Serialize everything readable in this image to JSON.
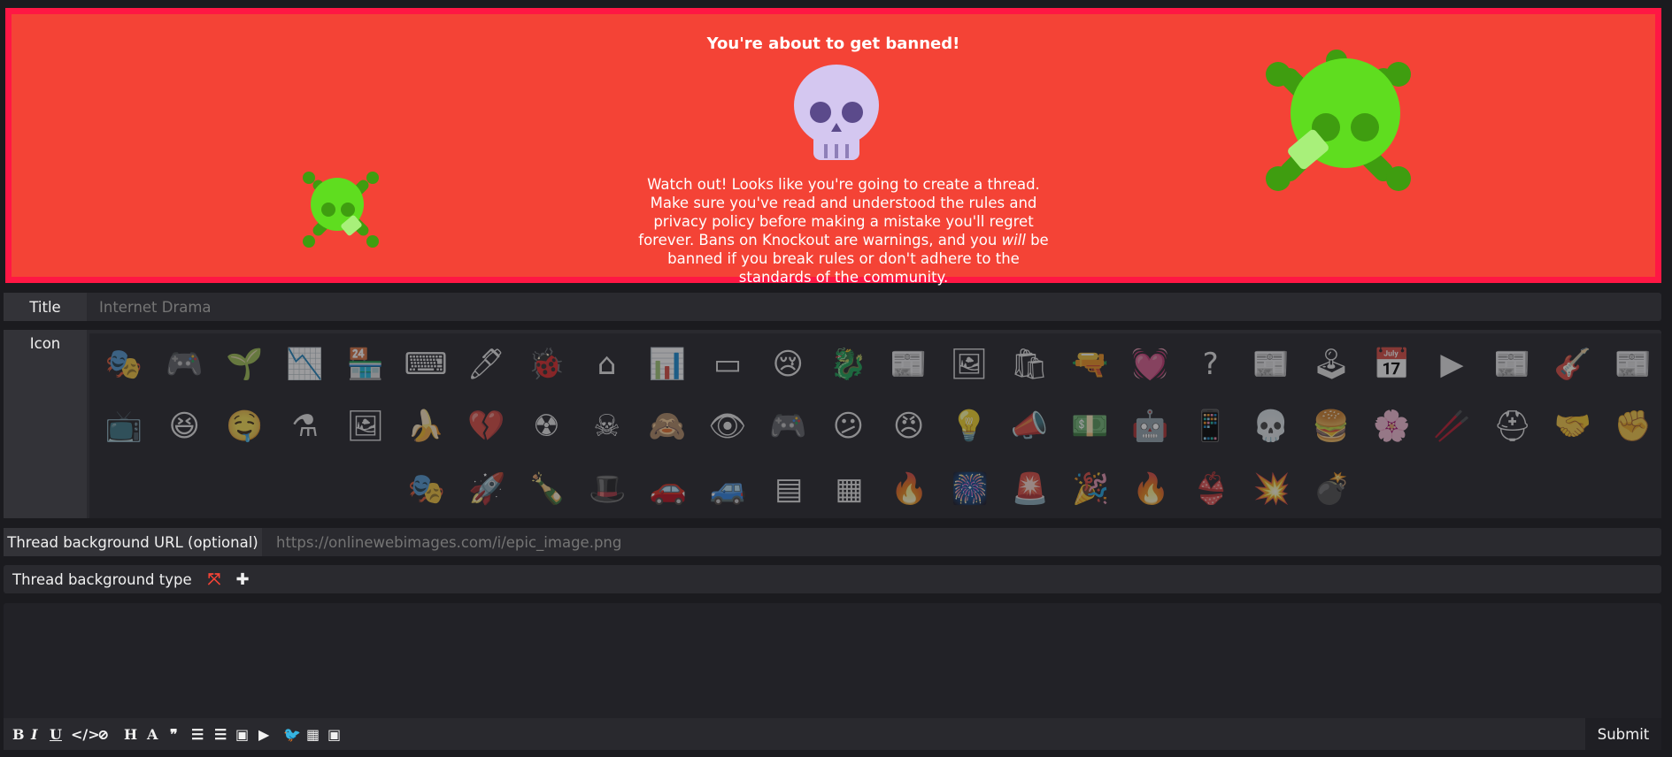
{
  "banner": {
    "title": "You're about to get banned!",
    "text_line1": "Watch out! Looks like you're going to create a thread.",
    "text_line2": "Make sure you've read and understood the rules and privacy policy before making a mistake you'll regret forever. Bans on Knockout are warnings, and you ",
    "text_em": "will",
    "text_line3": " be banned if you break rules or don't adhere to the standards of the community."
  },
  "title_field": {
    "label": "Title",
    "placeholder": "Internet Drama"
  },
  "icon_field": {
    "label": "Icon",
    "icons": [
      "drama-icon",
      "games-icon",
      "life-stuff-icon",
      "chart-down-icon",
      "shop-icon",
      "typewriter-icon",
      "pen-icon",
      "bug-icon",
      "code-window-icon",
      "bar-chart-icon",
      "browser-window-icon",
      "crying-face-icon",
      "dota-icon",
      "eu-news-icon",
      "image-gallery-icon",
      "grocery-bag-icon",
      "gun-icon",
      "heartbeat-icon",
      "question-icon",
      "newspaper-icon",
      "nes-console-icon",
      "calendar-icon",
      "video-player-icon",
      "uk-news-icon",
      "guitar-icon",
      "us-news-icon",
      "tv-icon",
      "laughing-face-icon",
      "drooling-face-icon",
      "flask-icon",
      "easel-icon",
      "banana-icon",
      "broken-heart-icon",
      "radioactive-icon",
      "skull-crossbones-icon",
      "eye-slash-icon",
      "eye-icon",
      "gamepad-icon",
      "confused-face-icon",
      "angry-face-icon",
      "lightbulb-icon",
      "megaphone-icon",
      "money-icon",
      "robot-icon",
      "phone-icon",
      "skull-icon",
      "burger-icon",
      "flowers-icon",
      "chopsticks-icon",
      "lifebuoy-icon",
      "handshake-icon",
      "fist-icon",
      "guy-fawkes-mask-icon",
      "rocket-icon",
      "bottle-icon",
      "witch-hat-icon",
      "car-icon",
      "car-front-icon",
      "ram-chip-icon",
      "cpu-chip-icon",
      "fire-icon",
      "firework-icon",
      "siren-icon",
      "party-popper-icon",
      "campfire-icon",
      "underwear-icon",
      "explosion-icon",
      "bomb-icon"
    ],
    "glyphs": [
      "🎭",
      "🎮",
      "🌱",
      "📉",
      "🏪",
      "⌨",
      "🖊",
      "🐞",
      "⌂",
      "📊",
      "▭",
      "😢",
      "🐉",
      "📰",
      "🖼",
      "🛍",
      "🔫",
      "💓",
      "?",
      "📰",
      "🕹",
      "📅",
      "▶",
      "📰",
      "🎸",
      "📰",
      "📺",
      "😆",
      "🤤",
      "⚗",
      "🖼",
      "🍌",
      "💔",
      "☢",
      "☠",
      "🙈",
      "👁",
      "🎮",
      "😕",
      "😠",
      "💡",
      "📣",
      "💵",
      "🤖",
      "📱",
      "💀",
      "🍔",
      "🌸",
      "🥢",
      "⛑",
      "🤝",
      "✊",
      "🎭",
      "🚀",
      "🍾",
      "🎩",
      "🚗",
      "🚙",
      "▤",
      "▦",
      "🔥",
      "🎆",
      "🚨",
      "🎉",
      "🔥",
      "👙",
      "💥",
      "💣"
    ]
  },
  "bg_url_field": {
    "label": "Thread background URL (optional)",
    "placeholder": "https://onlinewebimages.com/i/epic_image.png"
  },
  "bg_type_field": {
    "label": "Thread background type"
  },
  "editor": {
    "toolbar": [
      "B",
      "I",
      "U",
      "</>",
      "⊘",
      "H",
      "A",
      "❞",
      "☰",
      "☰",
      "▣",
      "▶",
      "🐦",
      "▦",
      "▣"
    ],
    "submit_label": "Submit"
  },
  "colors": {
    "banner_bg": "#f44336",
    "banner_border": "#ff1744",
    "skull_green": "#5fdd1f",
    "skull_lavender": "#d4c7f0",
    "page_bg": "#1b1b1f"
  }
}
